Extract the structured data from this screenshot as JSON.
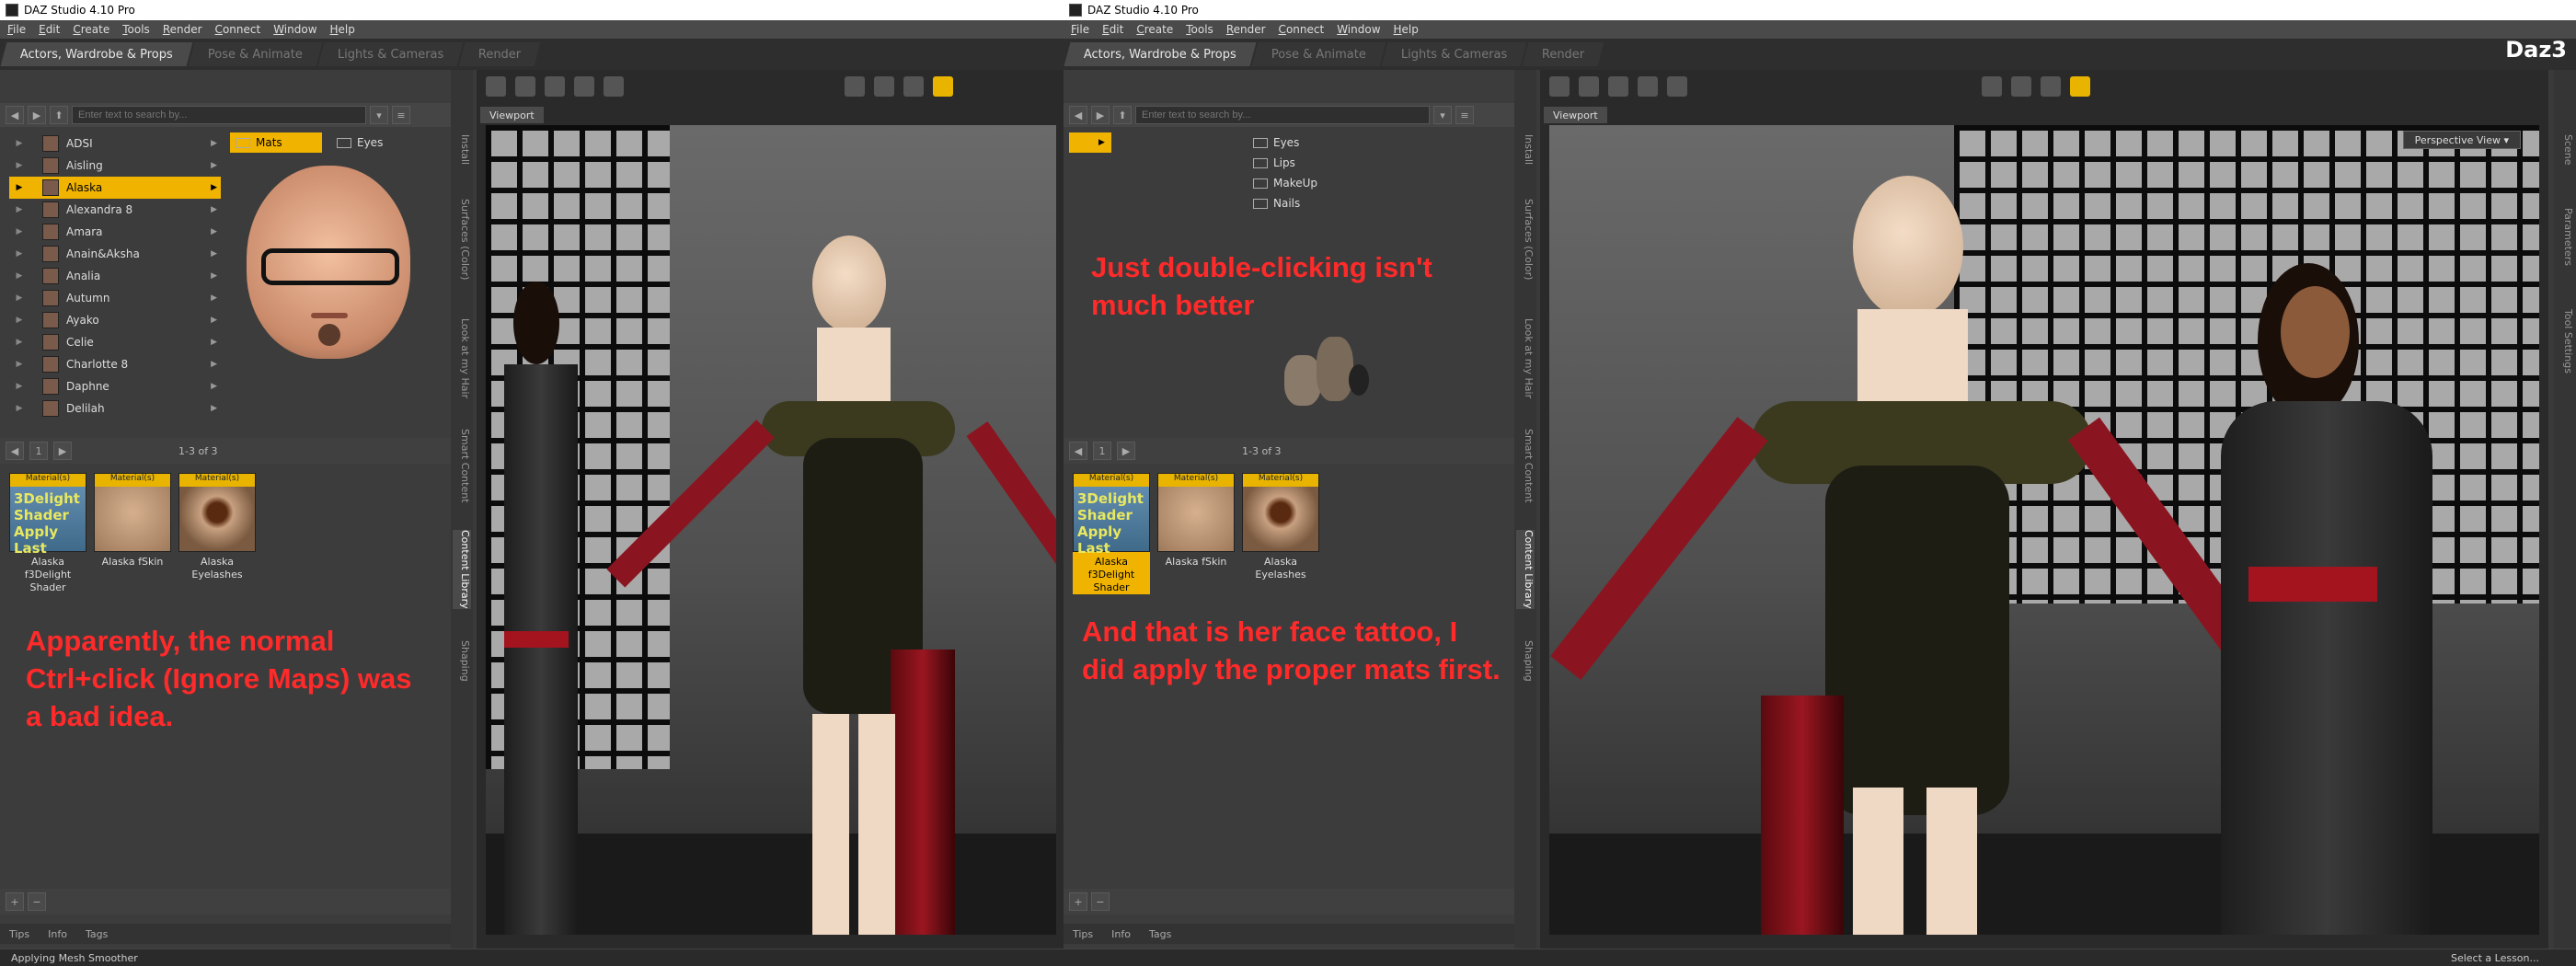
{
  "window_title": "DAZ Studio 4.10 Pro",
  "menu": [
    "File",
    "Edit",
    "Create",
    "Tools",
    "Render",
    "Connect",
    "Window",
    "Help"
  ],
  "room_tabs": [
    "Actors, Wardrobe & Props",
    "Pose & Animate",
    "Lights & Cameras",
    "Render"
  ],
  "brand_text": "Daz3",
  "search_placeholder": "Enter text to search by...",
  "tree_items": [
    "ADSI",
    "Aisling",
    "Alaska",
    "Alexandra 8",
    "Amara",
    "Anain&Aksha",
    "Analia",
    "Autumn",
    "Ayako",
    "Celie",
    "Charlotte 8",
    "Daphne",
    "Delilah"
  ],
  "tree_selected": "Alaska",
  "left_sub": {
    "selected": "Mats",
    "items": [
      "Eyes"
    ]
  },
  "right_sub_items": [
    "Eyes",
    "Lips",
    "MakeUp",
    "Nails"
  ],
  "result_count": "1-3 of 3",
  "assets": [
    {
      "badge": "Material(s)",
      "thumb_text": "3Delight Shader Apply Last",
      "label": "Alaska f3Delight Shader"
    },
    {
      "badge": "Material(s)",
      "label": "Alaska fSkin"
    },
    {
      "badge": "Material(s)",
      "label": "Alaska Eyelashes"
    }
  ],
  "side_tabs": [
    "Install",
    "Surfaces (Color)",
    "Look at my Hair",
    "Smart Content",
    "Content Library",
    "Shaping"
  ],
  "right_side_tabs": [
    "Scene",
    "Parameters",
    "Tool Settings"
  ],
  "bottom_tabs": [
    "Tips",
    "Info",
    "Tags"
  ],
  "viewport_tab": "Viewport",
  "perspective": "Perspective View",
  "annotations": {
    "left": "Apparently, the normal Ctrl+click (Ignore Maps) was a bad idea.",
    "middle": "Just double-clicking isn't much better",
    "right": "And that is her face tattoo, I did apply the proper mats first."
  },
  "status_left": "Applying Mesh Smoother",
  "status_right": "Select a Lesson...",
  "colors": {
    "accent": "#f0b400",
    "annotation": "#ff2a2a"
  }
}
